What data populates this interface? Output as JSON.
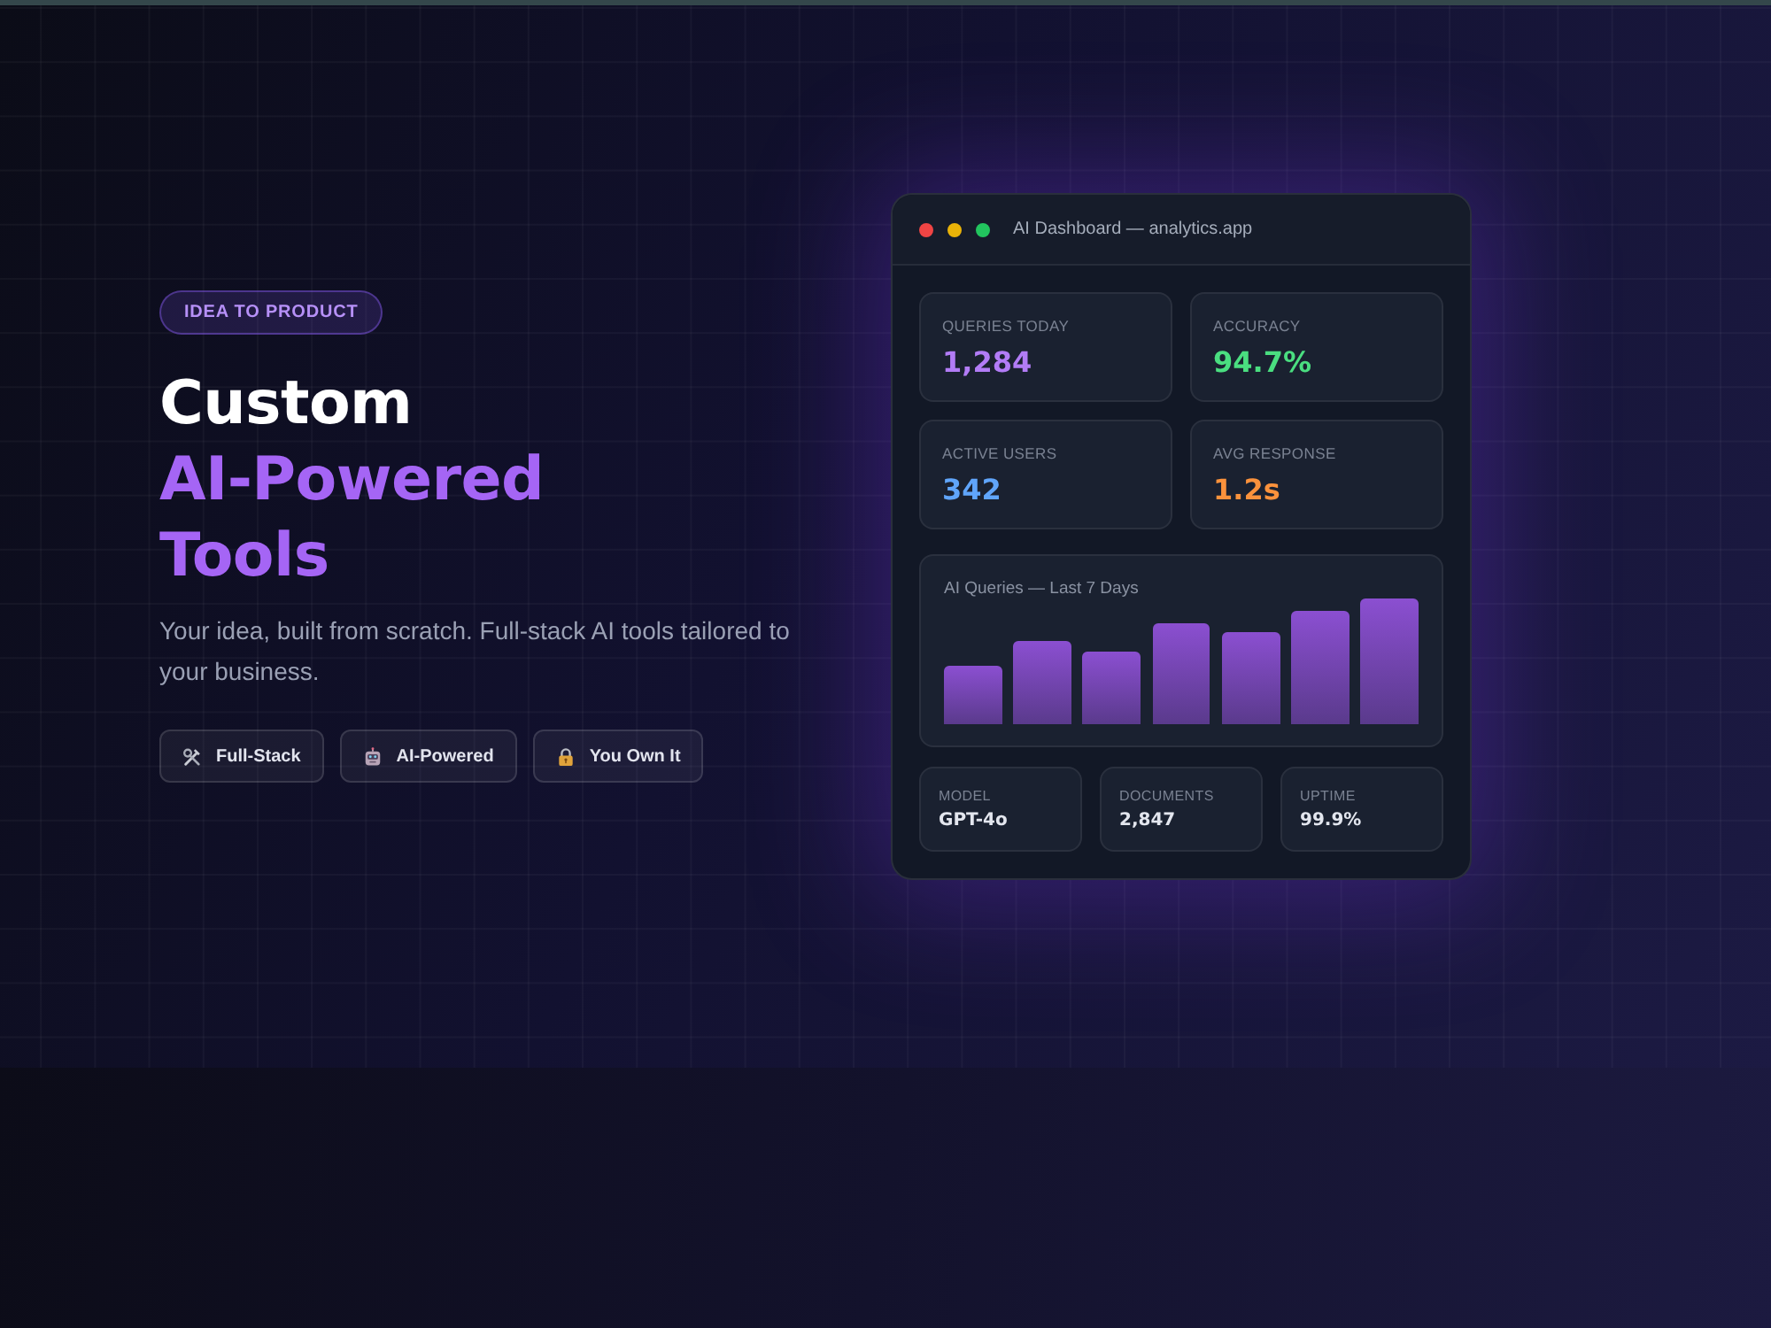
{
  "hero": {
    "badge": "IDEA TO PRODUCT",
    "heading": {
      "text": "Custom",
      "highlight": "AI-Powered Tools"
    },
    "subtitle": "Your idea, built from scratch. Full-stack AI tools tailored to your business.",
    "chips": [
      {
        "label": "Full-Stack"
      },
      {
        "label": "AI-Powered"
      },
      {
        "label": "You Own It"
      }
    ]
  },
  "dashboard": {
    "title": "AI Dashboard — analytics.app",
    "stats": [
      {
        "label": "QUERIES TODAY",
        "value": "1,284",
        "color": "#b27cf6"
      },
      {
        "label": "ACCURACY",
        "value": "94.7%",
        "color": "#4ade80"
      },
      {
        "label": "ACTIVE USERS",
        "value": "342",
        "color": "#60a5fa"
      },
      {
        "label": "AVG RESPONSE",
        "value": "1.2s",
        "color": "#fb923c"
      }
    ],
    "chart": {
      "title": "AI Queries — Last 7 Days"
    },
    "details": [
      {
        "label": "MODEL",
        "value": "GPT-4o"
      },
      {
        "label": "DOCUMENTS",
        "value": "2,847"
      },
      {
        "label": "UPTIME",
        "value": "99.9%"
      }
    ]
  }
}
